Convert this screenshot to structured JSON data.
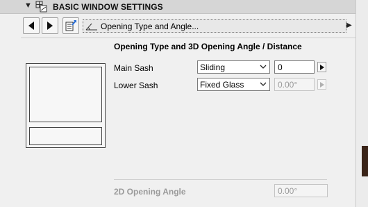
{
  "header": {
    "title": "BASIC WINDOW SETTINGS",
    "collapse_icon": "triangle-down-icon",
    "panel_icon": "window-settings-icon"
  },
  "toolbar": {
    "prev_icon": "triangle-left-icon",
    "next_icon": "triangle-right-icon",
    "panel_list_icon": "panel-list-icon",
    "panel_selector_label": "Opening Type and Angle...",
    "panel_selector_icon": "opening-angle-icon"
  },
  "main": {
    "section_title": "Opening Type and 3D Opening Angle / Distance",
    "rows": [
      {
        "label": "Main Sash",
        "type_value": "Sliding",
        "amount_value": "0",
        "enabled": true
      },
      {
        "label": "Lower Sash",
        "type_value": "Fixed Glass",
        "amount_value": "0.00°",
        "enabled": false
      }
    ],
    "opening_angle_2d": {
      "label": "2D Opening Angle",
      "value": "0.00°",
      "enabled": false
    }
  }
}
